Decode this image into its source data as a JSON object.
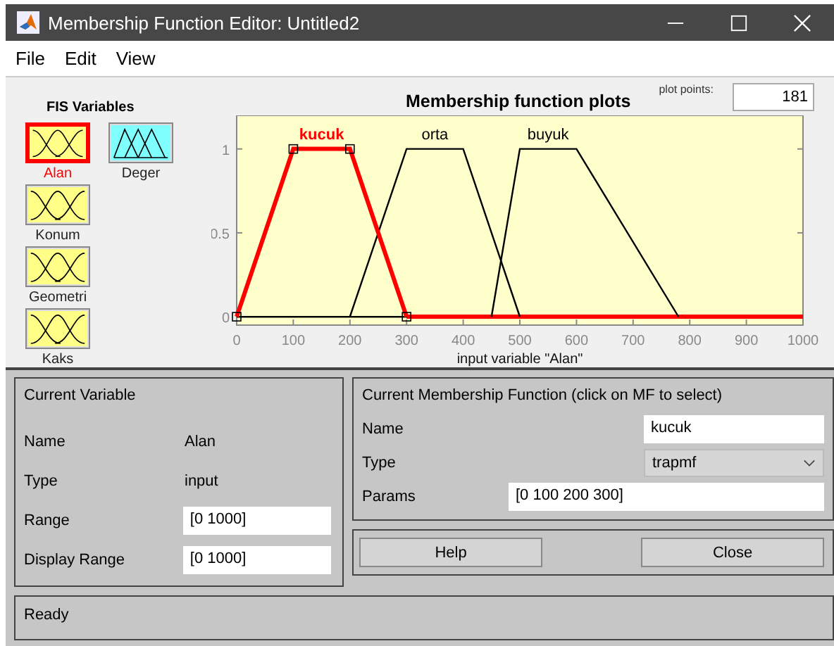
{
  "window": {
    "title": "Membership Function Editor: Untitled2"
  },
  "menu": [
    "File",
    "Edit",
    "View"
  ],
  "fis_variables": {
    "title": "FIS Variables",
    "items": [
      {
        "name": "Alan",
        "kind": "input",
        "selected": true
      },
      {
        "name": "Deger",
        "kind": "output",
        "selected": false
      },
      {
        "name": "Konum",
        "kind": "input",
        "selected": false
      },
      {
        "name": "Geometri",
        "kind": "input",
        "selected": false
      },
      {
        "name": "Kaks",
        "kind": "input",
        "selected": false
      }
    ]
  },
  "plot": {
    "plot_points_label": "plot points:",
    "plot_points": "181",
    "chart_data": {
      "type": "line",
      "title": "Membership function plots",
      "xlabel": "input variable \"Alan\"",
      "x": [
        0,
        100,
        200,
        300,
        400,
        450,
        500,
        600,
        780,
        1000
      ],
      "series": [
        {
          "name": "kucuk",
          "color": "#ff0000",
          "values": [
            0,
            1,
            1,
            0,
            0,
            0,
            0,
            0,
            0,
            0
          ]
        },
        {
          "name": "orta",
          "color": "#000000",
          "values": [
            null,
            null,
            0,
            1,
            1,
            0.5,
            0,
            null,
            null,
            null
          ]
        },
        {
          "name": "buyuk",
          "color": "#000000",
          "values": [
            null,
            null,
            null,
            null,
            null,
            0,
            1,
            1,
            0,
            null
          ]
        }
      ],
      "xlim": [
        0,
        1000
      ],
      "ylim": [
        -0.05,
        1.2
      ],
      "xticks": [
        0,
        100,
        200,
        300,
        400,
        500,
        600,
        700,
        800,
        900,
        1000
      ],
      "yticks": [
        0,
        0.5,
        1
      ]
    },
    "curves": [
      {
        "selected": true
      },
      {
        "selected": false
      },
      {
        "selected": false
      }
    ]
  },
  "current_variable": {
    "title": "Current Variable",
    "rows": [
      {
        "label": "Name",
        "value": "Alan",
        "kind": "text"
      },
      {
        "label": "Type",
        "value": "input",
        "kind": "text"
      },
      {
        "label": "Range",
        "value": "[0 1000]",
        "kind": "field"
      },
      {
        "label": "Display Range",
        "value": "[0 1000]",
        "kind": "field"
      }
    ]
  },
  "current_mf": {
    "title": "Current Membership Function (click on MF to select)",
    "name_label": "Name",
    "name": "kucuk",
    "type_label": "Type",
    "type": "trapmf",
    "params_label": "Params",
    "params": "[0 100 200 300]"
  },
  "buttons": [
    "Help",
    "Close"
  ],
  "status_bar": "Ready"
}
